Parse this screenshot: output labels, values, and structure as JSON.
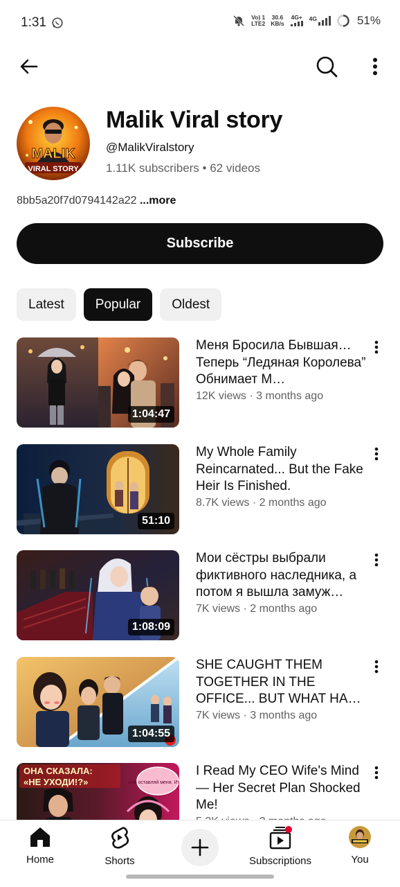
{
  "status_bar": {
    "time": "1:31",
    "network_1": "Vo) 1",
    "network_1b": "LTE2",
    "speed": "30.6",
    "speed_unit": "KB/s",
    "net_4g_plus": "4G+",
    "net_4g": "4G",
    "battery": "51%"
  },
  "channel": {
    "name": "Malik Viral story",
    "handle": "@MalikViralstory",
    "subscribers": "1.11K subscribers",
    "separator": " • ",
    "videos_count": "62 videos",
    "description": "8bb5a20f7d0794142a22",
    "more_label": " ...more",
    "avatar_text_top": "MALIK",
    "avatar_text_bottom": "VIRAL STORY"
  },
  "subscribe_label": "Subscribe",
  "chips": [
    {
      "label": "Latest",
      "active": false
    },
    {
      "label": "Popular",
      "active": true
    },
    {
      "label": "Oldest",
      "active": false
    }
  ],
  "videos": [
    {
      "title": "Меня Бросила Бывшая… Теперь “Ледяная Королева” Обнимает М…",
      "meta": "12K views · 3 months ago",
      "duration": "1:04:47"
    },
    {
      "title": "My Whole Family Reincarnated... But the Fake Heir Is Finished.",
      "meta": "8.7K views · 2 months ago",
      "duration": "51:10"
    },
    {
      "title": "Мои сёстры выбрали фиктивного наследника, а потом я вышла замуж…",
      "meta": "7K views · 2 months ago",
      "duration": "1:08:09"
    },
    {
      "title": "SHE CAUGHT THEM TOGETHER IN THE OFFICE... BUT WHAT HA…",
      "meta": "7K views · 3 months ago",
      "duration": "1:04:55"
    },
    {
      "title": "I Read My CEO Wife's Mind — Her Secret Plan Shocked Me!",
      "meta": "5.3K views · 2 months ago",
      "duration": "",
      "thumb_text_1": "ОНА СКАЗАЛА:",
      "thumb_text_2": "«НЕ УХОДИ!?»",
      "thumb_text_3": "«Не оставляй меня, Итан»"
    }
  ],
  "nav": {
    "home": "Home",
    "shorts": "Shorts",
    "subscriptions": "Subscriptions",
    "you": "You"
  }
}
